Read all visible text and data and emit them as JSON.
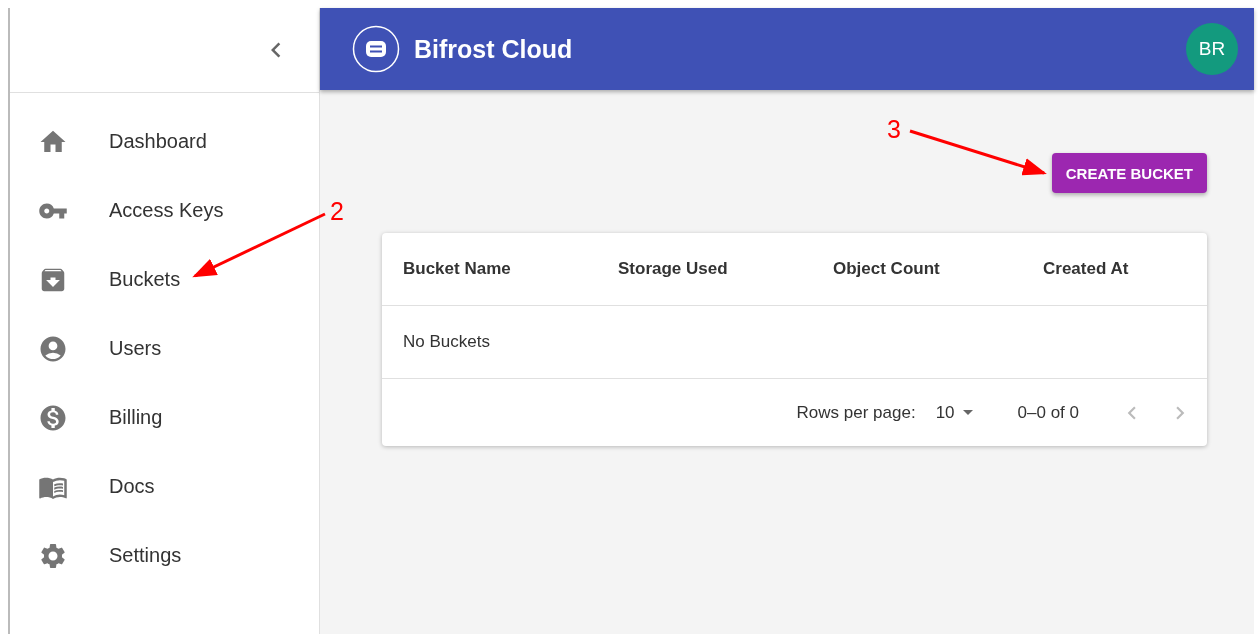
{
  "sidebar": {
    "items": [
      {
        "kind": "home",
        "label": "Dashboard"
      },
      {
        "kind": "key",
        "label": "Access Keys"
      },
      {
        "kind": "archive",
        "label": "Buckets"
      },
      {
        "kind": "user",
        "label": "Users"
      },
      {
        "kind": "dollar",
        "label": "Billing"
      },
      {
        "kind": "book",
        "label": "Docs"
      },
      {
        "kind": "gear",
        "label": "Settings"
      }
    ]
  },
  "header": {
    "title": "Bifrost Cloud",
    "avatar": "BR"
  },
  "create_button": "CREATE BUCKET",
  "table": {
    "columns": [
      "Bucket Name",
      "Storage Used",
      "Object Count",
      "Created At"
    ],
    "empty_message": "No Buckets",
    "pagination": {
      "rows_per_page_label": "Rows per page:",
      "rows_per_page": "10",
      "range": "0–0 of 0"
    }
  },
  "annotations": [
    {
      "label": "2"
    },
    {
      "label": "3"
    }
  ]
}
